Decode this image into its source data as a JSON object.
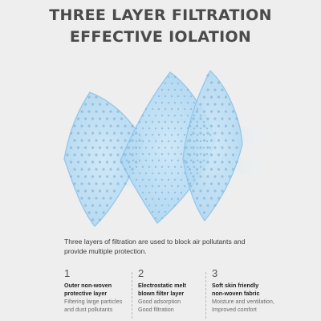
{
  "header": {
    "title_line_1": "THREE LAYER FILTRATION",
    "title_line_2": "EFFECTIVE IOLATION"
  },
  "illustration": {
    "icons": [
      "filter-sheet-icon",
      "air-flow-icon"
    ],
    "colors": {
      "filter_fill": "#bfe0f5",
      "filter_edge": "#8fc5ea",
      "air_flow": "#d9ecfa",
      "perforation": "#8bb6d3"
    }
  },
  "intro": {
    "text": "Three layers of filtration are used to block air pollutants and provide multiple protection."
  },
  "layers": [
    {
      "number": "1",
      "name_line_1": "Outer non-woven",
      "name_line_2": "protective layer",
      "desc_line_1": "Filtering large particles",
      "desc_line_2": "and dust pollutants"
    },
    {
      "number": "2",
      "name_line_1": "Electrostatic melt",
      "name_line_2": "blown filter layer",
      "desc_line_1": "Good adsorption",
      "desc_line_2": "Good filtration"
    },
    {
      "number": "3",
      "name_line_1": "Soft skin friendly",
      "name_line_2": "non-woven fabric",
      "desc_line_1": "Moisture and ventilation,",
      "desc_line_2": "Improved comfort"
    }
  ]
}
